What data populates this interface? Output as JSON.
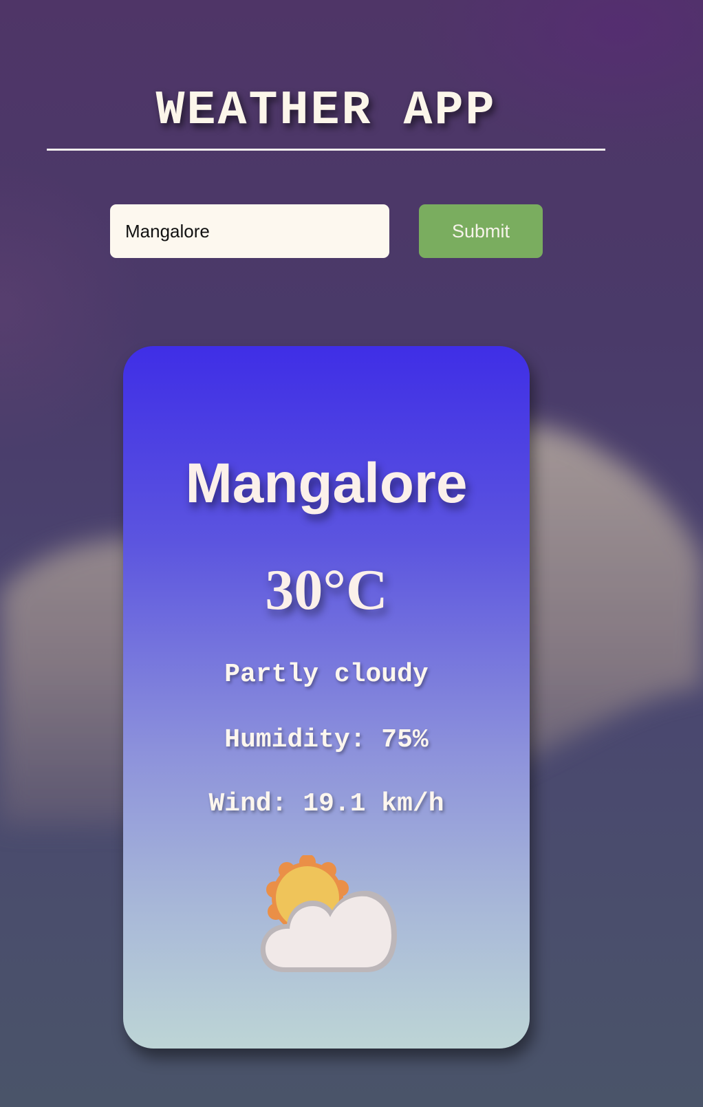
{
  "header": {
    "title": "WEATHER APP"
  },
  "search": {
    "value": "Mangalore",
    "submit_label": "Submit"
  },
  "card": {
    "city": "Mangalore",
    "temperature": "30°C",
    "condition": "Partly cloudy",
    "humidity": "Humidity: 75%",
    "wind": "Wind: 19.1 km/h",
    "icon": "partly-cloudy-icon"
  },
  "colors": {
    "submit_button": "#7aad5f",
    "card_top": "#3f2ee6",
    "card_bottom": "#bdd5d6",
    "text_light": "#fbf0ea"
  }
}
